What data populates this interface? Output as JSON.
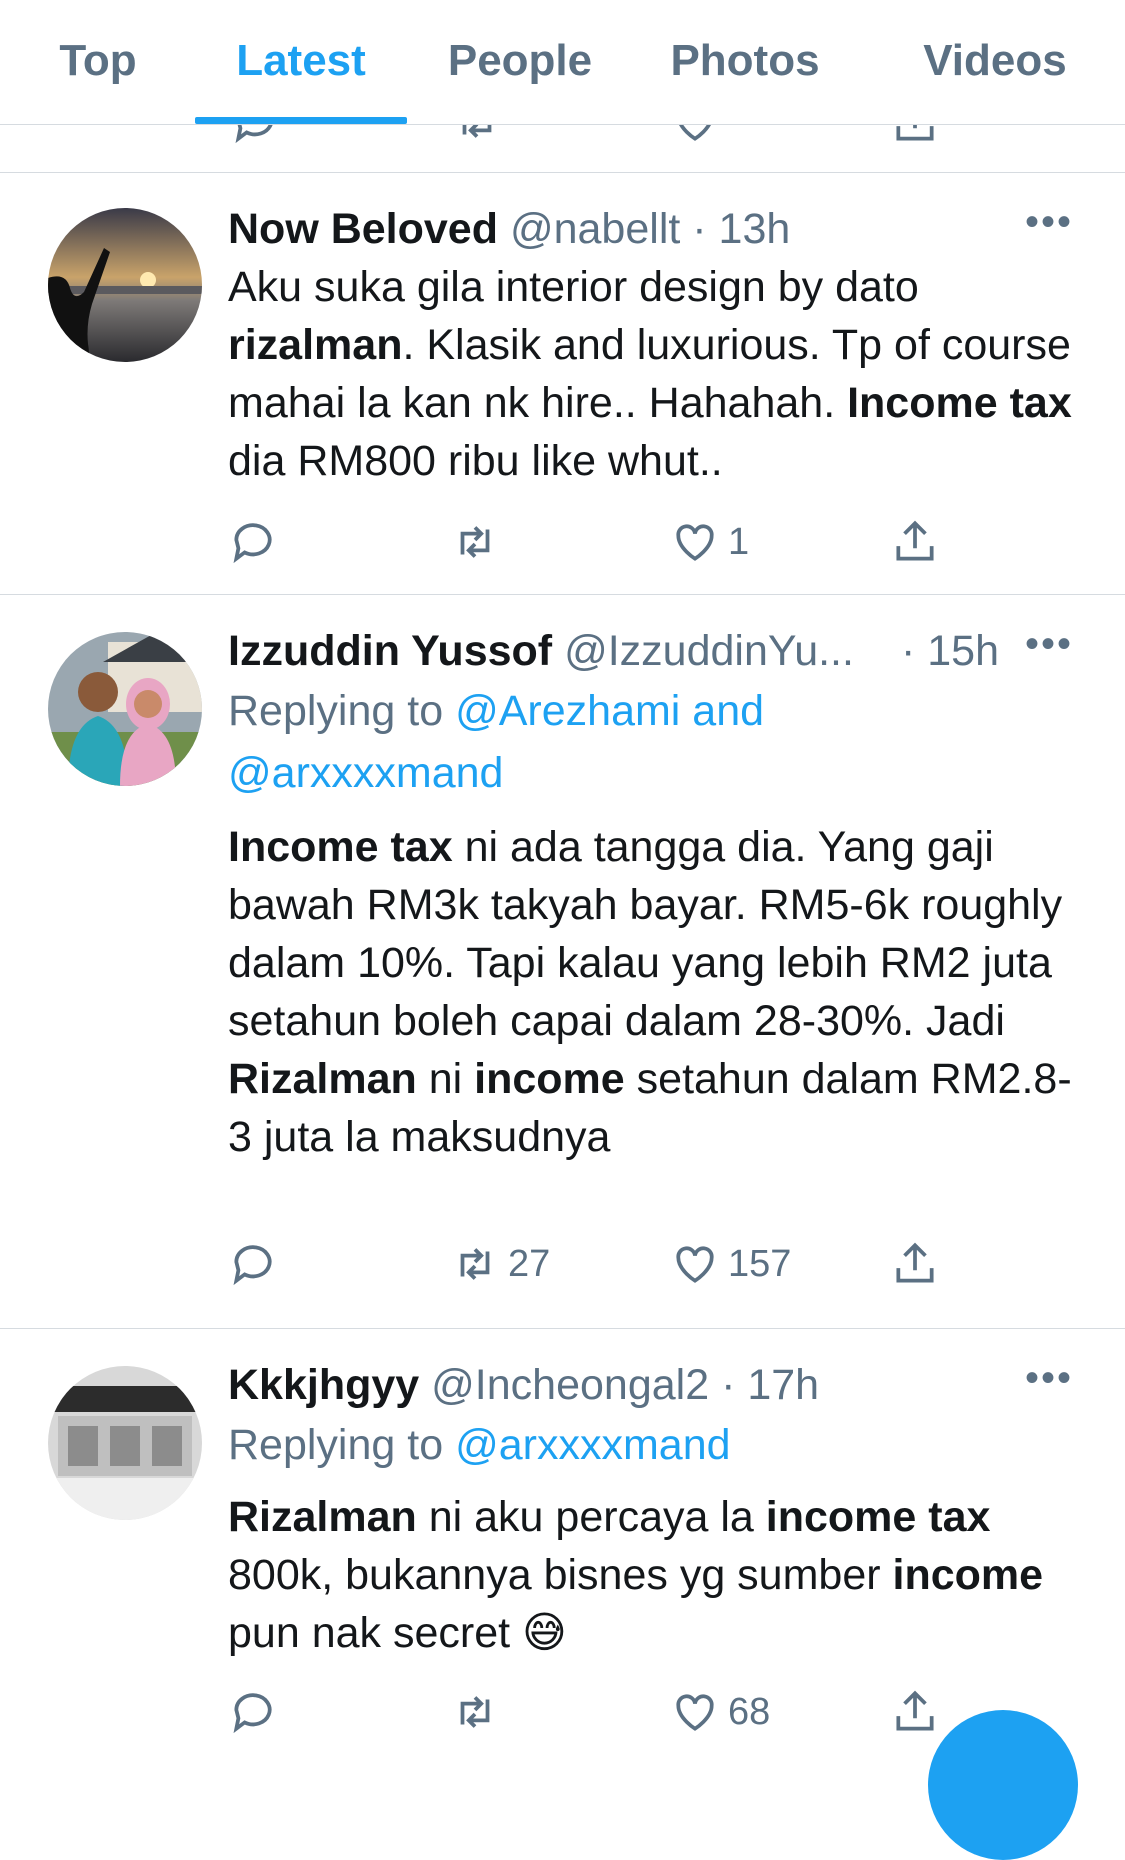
{
  "tabs": [
    "Top",
    "Latest",
    "People",
    "Photos",
    "Videos"
  ],
  "active_tab": "Latest",
  "accent_color": "#1da1f2",
  "tweets": [
    {
      "name": "Now Beloved",
      "handle": "@nabellt",
      "time": "· 13h",
      "more": "•••",
      "avatar": "sunset-silhouette-avatar",
      "body_segments": [
        {
          "text": "Aku suka gila interior design by dato ",
          "bold": false
        },
        {
          "text": "rizalman",
          "bold": true
        },
        {
          "text": ". Klasik and luxurious. Tp of course mahai la kan nk hire.. Hahahah. ",
          "bold": false
        },
        {
          "text": "Income tax",
          "bold": true
        },
        {
          "text": " dia RM800 ribu like whut..",
          "bold": false
        }
      ],
      "replies": "",
      "retweets": "",
      "likes": "1"
    },
    {
      "name": "Izzuddin Yussof",
      "handle": "@IzzuddinYu...",
      "time": "· 15h",
      "more": "•••",
      "avatar": "couple-photo-avatar",
      "replying_prefix": "Replying to",
      "replying_to_1": "@Arezhami and",
      "replying_to_2": "@arxxxxmand",
      "body_segments": [
        {
          "text": "Income tax",
          "bold": true
        },
        {
          "text": " ni ada tangga dia. Yang gaji bawah RM3k takyah bayar. RM5-6k roughly dalam 10%. Tapi kalau yang lebih RM2 juta setahun boleh capai dalam 28-30%. Jadi ",
          "bold": false
        },
        {
          "text": "Rizalman",
          "bold": true
        },
        {
          "text": " ni ",
          "bold": false
        },
        {
          "text": "income",
          "bold": true
        },
        {
          "text": " setahun dalam RM2.8-3 juta la maksudnya",
          "bold": false
        }
      ],
      "replies": "",
      "retweets": "27",
      "likes": "157"
    },
    {
      "name": "Kkkjhgyy",
      "handle": "@Incheongal2",
      "time": "· 17h",
      "more": "•••",
      "avatar": "building-interior-avatar",
      "replying_prefix": "Replying to",
      "replying_to_1": "@arxxxxmand",
      "body_segments": [
        {
          "text": "Rizalman",
          "bold": true
        },
        {
          "text": " ni aku percaya la ",
          "bold": false
        },
        {
          "text": "income tax",
          "bold": true
        },
        {
          "text": " 800k, bukannya bisnes yg sumber ",
          "bold": false
        },
        {
          "text": "income",
          "bold": true
        },
        {
          "text": " pun nak secret ",
          "bold": false
        },
        {
          "text": "😅",
          "bold": false
        }
      ],
      "replies": "",
      "retweets": "",
      "likes": "68"
    }
  ]
}
